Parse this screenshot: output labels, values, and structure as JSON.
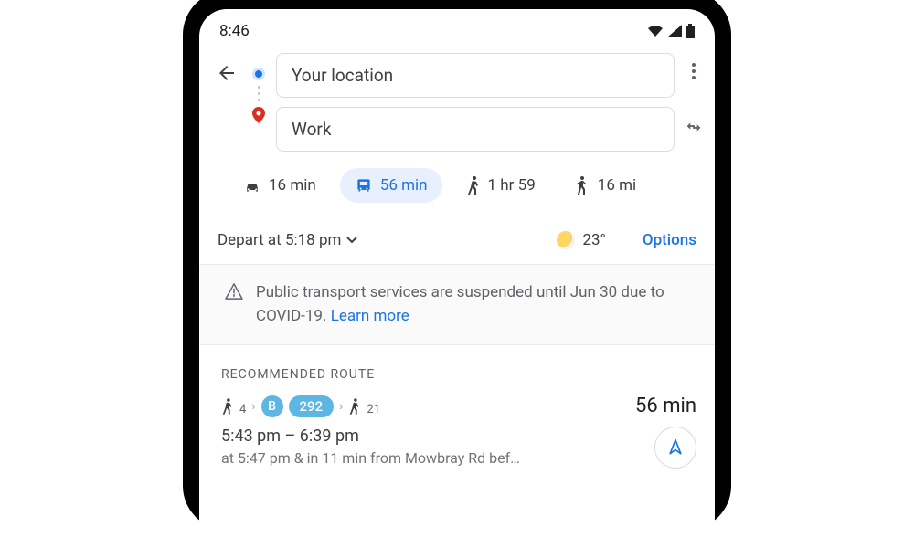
{
  "status": {
    "time": "8:46"
  },
  "directions": {
    "origin": "Your location",
    "destination": "Work"
  },
  "modes": {
    "car": {
      "label": "16 min"
    },
    "transit": {
      "label": "56 min"
    },
    "walk": {
      "label": "1 hr 59"
    },
    "rideshare": {
      "label": "16 mi"
    }
  },
  "depart": {
    "label": "Depart at 5:18 pm",
    "temp": "23°",
    "options": "Options"
  },
  "alert": {
    "text": "Public transport services are suspended until Jun 30 due to COVID-19.",
    "learn": "Learn more"
  },
  "recommended": {
    "header": "Recommended Route",
    "walk1_min": "4",
    "bus_letter": "B",
    "bus_number": "292",
    "walk2_min": "21",
    "duration": "56 min",
    "time_range": "5:43 pm – 6:39 pm",
    "detail": "at 5:47 pm & in 11 min from Mowbray Rd bef…"
  }
}
